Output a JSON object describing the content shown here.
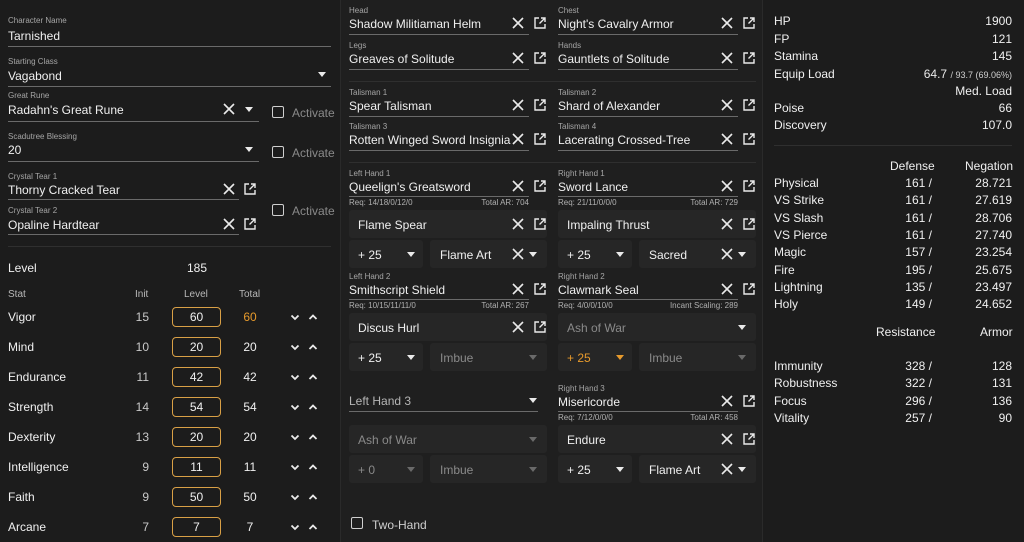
{
  "character": {
    "name_label": "Character Name",
    "name": "Tarnished",
    "class_label": "Starting Class",
    "class": "Vagabond",
    "great_rune_label": "Great Rune",
    "great_rune": "Radahn's Great Rune",
    "scadutree_label": "Scadutree Blessing",
    "scadutree": "20",
    "tear1_label": "Crystal Tear 1",
    "tear1": "Thorny Cracked Tear",
    "tear2_label": "Crystal Tear 2",
    "tear2": "Opaline Hardtear",
    "activate_label": "Activate",
    "level_label": "Level",
    "level": "185"
  },
  "stats": {
    "headers": {
      "stat": "Stat",
      "init": "Init",
      "level": "Level",
      "total": "Total"
    },
    "rows": [
      {
        "name": "Vigor",
        "init": "15",
        "level": "60",
        "total": "60",
        "highlight": true
      },
      {
        "name": "Mind",
        "init": "10",
        "level": "20",
        "total": "20"
      },
      {
        "name": "Endurance",
        "init": "11",
        "level": "42",
        "total": "42"
      },
      {
        "name": "Strength",
        "init": "14",
        "level": "54",
        "total": "54"
      },
      {
        "name": "Dexterity",
        "init": "13",
        "level": "20",
        "total": "20"
      },
      {
        "name": "Intelligence",
        "init": "9",
        "level": "11",
        "total": "11"
      },
      {
        "name": "Faith",
        "init": "9",
        "level": "50",
        "total": "50"
      },
      {
        "name": "Arcane",
        "init": "7",
        "level": "7",
        "total": "7"
      }
    ]
  },
  "armor": {
    "head_label": "Head",
    "head": "Shadow Militiaman Helm",
    "chest_label": "Chest",
    "chest": "Night's Cavalry Armor",
    "legs_label": "Legs",
    "legs": "Greaves of Solitude",
    "hands_label": "Hands",
    "hands": "Gauntlets of Solitude"
  },
  "talismans": {
    "t1_label": "Talisman 1",
    "t1": "Spear Talisman",
    "t2_label": "Talisman 2",
    "t2": "Shard of Alexander",
    "t3_label": "Talisman 3",
    "t3": "Rotten Winged Sword Insignia",
    "t4_label": "Talisman 4",
    "t4": "Lacerating Crossed-Tree"
  },
  "weapons": {
    "lh1": {
      "label": "Left Hand 1",
      "name": "Queelign's Greatsword",
      "req": "Req: 14/18/0/12/0",
      "ar": "Total AR: 704",
      "ash": "Flame Spear",
      "upgrade": "+ 25",
      "affinity": "Flame Art"
    },
    "rh1": {
      "label": "Right Hand 1",
      "name": "Sword Lance",
      "req": "Req: 21/11/0/0/0",
      "ar": "Total AR: 729",
      "ash": "Impaling Thrust",
      "upgrade": "+ 25",
      "affinity": "Sacred"
    },
    "lh2": {
      "label": "Left Hand 2",
      "name": "Smithscript Shield",
      "req": "Req: 10/15/11/11/0",
      "ar": "Total AR: 267",
      "ash": "Discus Hurl",
      "upgrade": "+ 25",
      "affinity": "Imbue"
    },
    "rh2": {
      "label": "Right Hand 2",
      "name": "Clawmark Seal",
      "req": "Req: 4/0/0/10/0",
      "ar": "Incant Scaling: 289",
      "ash": "Ash of War",
      "upgrade": "+ 25",
      "affinity": "Imbue"
    },
    "lh3": {
      "placeholder": "Left Hand 3",
      "ash": "Ash of War",
      "upgrade": "+ 0",
      "affinity": "Imbue"
    },
    "rh3": {
      "label": "Right Hand 3",
      "name": "Misericorde",
      "req": "Req: 7/12/0/0/0",
      "ar": "Total AR: 458",
      "ash": "Endure",
      "upgrade": "+ 25",
      "affinity": "Flame Art"
    },
    "two_hand_label": "Two-Hand"
  },
  "summary": {
    "hp_label": "HP",
    "hp": "1900",
    "fp_label": "FP",
    "fp": "121",
    "stamina_label": "Stamina",
    "stamina": "145",
    "equip_label": "Equip Load",
    "equip_value": "64.7",
    "equip_detail": "/ 93.7 (69.06%)",
    "equip_class": "Med. Load",
    "poise_label": "Poise",
    "poise": "66",
    "discovery_label": "Discovery",
    "discovery": "107.0"
  },
  "defense": {
    "header_defense": "Defense",
    "header_negation": "Negation",
    "rows": [
      {
        "name": "Physical",
        "def": "161 /",
        "neg": "28.721"
      },
      {
        "name": "VS Strike",
        "def": "161 /",
        "neg": "27.619"
      },
      {
        "name": "VS Slash",
        "def": "161 /",
        "neg": "28.706"
      },
      {
        "name": "VS Pierce",
        "def": "161 /",
        "neg": "27.740"
      },
      {
        "name": "Magic",
        "def": "157 /",
        "neg": "23.254"
      },
      {
        "name": "Fire",
        "def": "195 /",
        "neg": "25.675"
      },
      {
        "name": "Lightning",
        "def": "135 /",
        "neg": "23.497"
      },
      {
        "name": "Holy",
        "def": "149 /",
        "neg": "24.652"
      }
    ]
  },
  "resistance": {
    "header_resistance": "Resistance",
    "header_armor": "Armor",
    "rows": [
      {
        "name": "Immunity",
        "res": "328 /",
        "armor": "128"
      },
      {
        "name": "Robustness",
        "res": "322 /",
        "armor": "131"
      },
      {
        "name": "Focus",
        "res": "296 /",
        "armor": "136"
      },
      {
        "name": "Vitality",
        "res": "257 /",
        "armor": "90"
      }
    ]
  },
  "colors": {
    "accent": "#e79a2c",
    "bg": "#1c1c1c",
    "card": "#262626"
  }
}
